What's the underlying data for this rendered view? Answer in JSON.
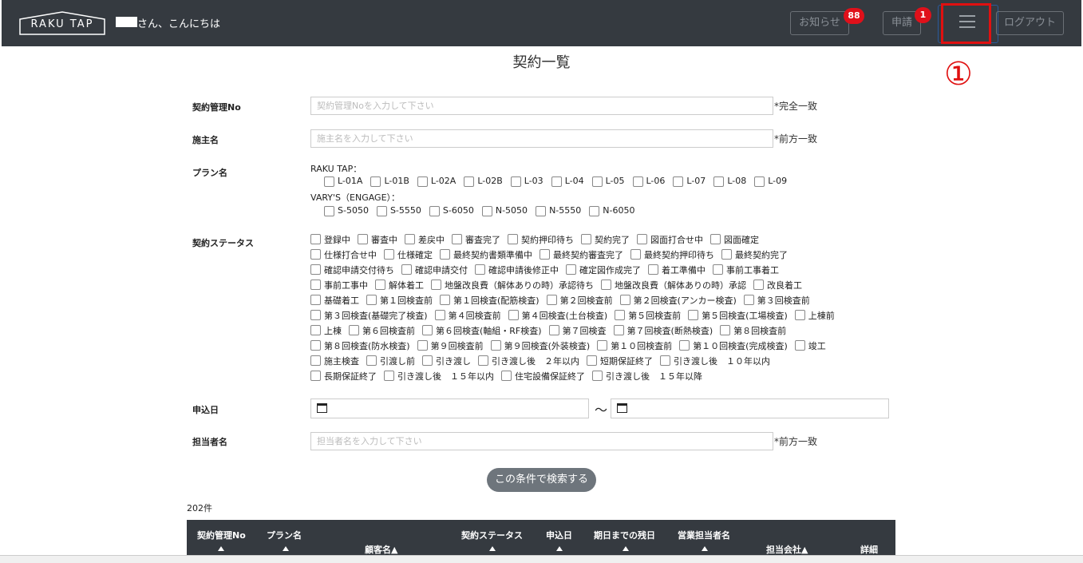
{
  "header": {
    "logo": "RAKU TAP",
    "greeting": "さん、こんにちは",
    "notice_label": "お知らせ",
    "notice_badge": "88",
    "apply_label": "申請",
    "apply_badge": "1",
    "logout_label": "ログアウト"
  },
  "annotation": "①",
  "page_title": "契約一覧",
  "form": {
    "contract_no": {
      "label": "契約管理No",
      "placeholder": "契約管理Noを入力して下さい",
      "hint": "*完全一致"
    },
    "owner": {
      "label": "施主名",
      "placeholder": "施主名を入力して下さい",
      "hint": "*前方一致"
    },
    "plan": {
      "label": "プラン名",
      "raku_head": "RAKU TAP：",
      "raku_items": [
        "L-01A",
        "L-01B",
        "L-02A",
        "L-02B",
        "L-03",
        "L-04",
        "L-05",
        "L-06",
        "L-07",
        "L-08",
        "L-09"
      ],
      "vary_head": "VARY'S（ENGAGE）：",
      "vary_items": [
        "S-5050",
        "S-5550",
        "S-6050",
        "N-5050",
        "N-5550",
        "N-6050"
      ]
    },
    "status": {
      "label": "契約ステータス",
      "rows": [
        [
          "登録中",
          "審査中",
          "差戻中",
          "審査完了",
          "契約押印待ち",
          "契約完了",
          "図面打合せ中",
          "図面確定"
        ],
        [
          "仕様打合せ中",
          "仕様確定",
          "最終契約書類準備中",
          "最終契約審査完了",
          "最終契約押印待ち",
          "最終契約完了"
        ],
        [
          "確認申請交付待ち",
          "確認申請交付",
          "確認申請後修正中",
          "確定図作成完了",
          "着工準備中",
          "事前工事着工"
        ],
        [
          "事前工事中",
          "解体着工",
          "地盤改良費（解体ありの時）承認待ち",
          "地盤改良費（解体ありの時）承認",
          "改良着工"
        ],
        [
          "基礎着工",
          "第１回検査前",
          "第１回検査(配筋検査)",
          "第２回検査前",
          "第２回検査(アンカー検査)",
          "第３回検査前"
        ],
        [
          "第３回検査(基礎完了検査)",
          "第４回検査前",
          "第４回検査(土台検査)",
          "第５回検査前",
          "第５回検査(工場検査)",
          "上棟前"
        ],
        [
          "上棟",
          "第６回検査前",
          "第６回検査(軸組・RF検査)",
          "第７回検査",
          "第７回検査(断熱検査)",
          "第８回検査前"
        ],
        [
          "第８回検査(防水検査)",
          "第９回検査前",
          "第９回検査(外装検査)",
          "第１０回検査前",
          "第１０回検査(完成検査)",
          "竣工"
        ],
        [
          "施主検査",
          "引渡し前",
          "引き渡し",
          "引き渡し後　２年以内",
          "短期保証終了",
          "引き渡し後　１０年以内"
        ],
        [
          "長期保証終了",
          "引き渡し後　１５年以内",
          "住宅設備保証終了",
          "引き渡し後　１５年以降"
        ]
      ]
    },
    "apply_date": {
      "label": "申込日",
      "separator": "～"
    },
    "staff": {
      "label": "担当者名",
      "placeholder": "担当者名を入力して下さい",
      "hint": "*前方一致"
    },
    "search_button": "この条件で検索する"
  },
  "result_count": "202件",
  "table": {
    "headers": {
      "contract_no": "契約管理No",
      "plan": "プラン名",
      "customer": "顧客名▲",
      "status": "契約ステータス",
      "apply_date": "申込日",
      "days_left": "期日までの残日",
      "sales_staff": "営業担当者名",
      "company": "担当会社▲",
      "detail": "詳細"
    }
  }
}
